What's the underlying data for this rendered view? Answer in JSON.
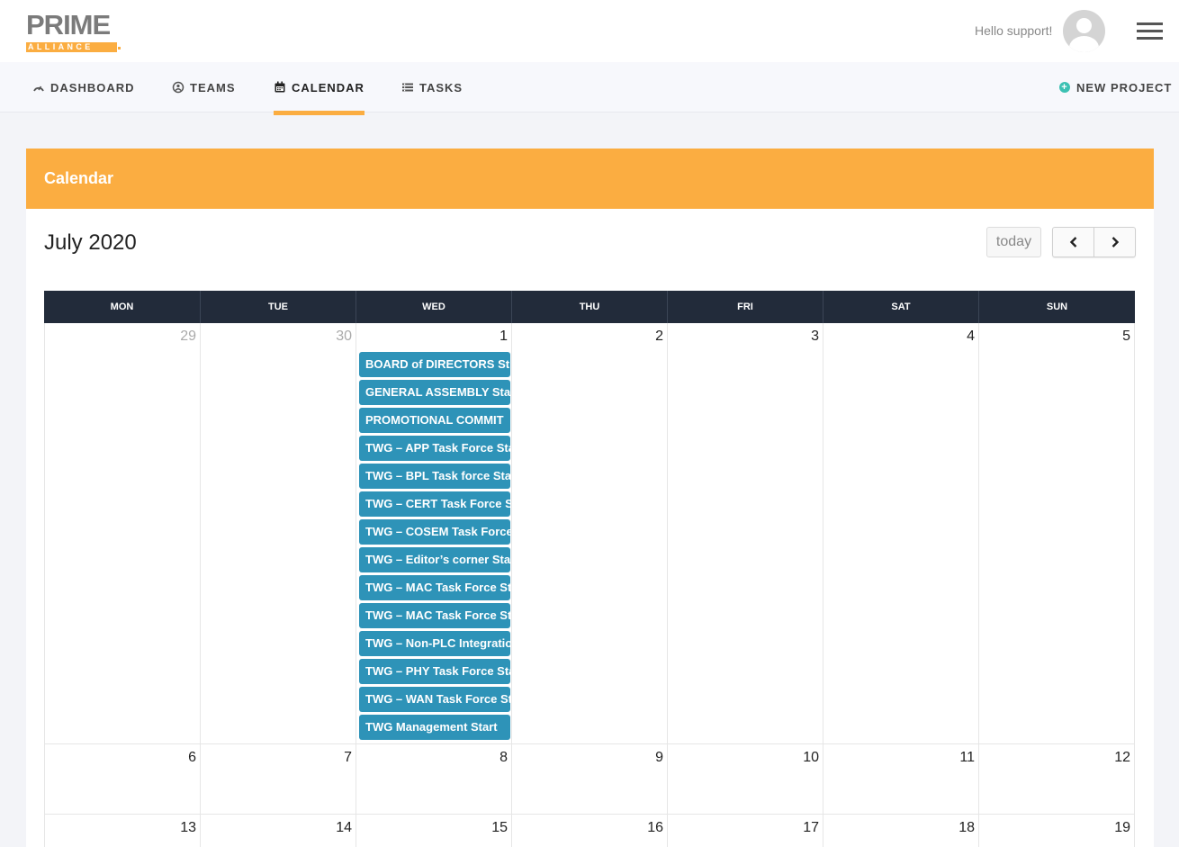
{
  "header": {
    "logo_main": "PRIME",
    "logo_sub": "ALLIANCE",
    "greeting": "Hello support!"
  },
  "nav": {
    "items": [
      {
        "label": "DASHBOARD",
        "icon": "gauge-icon"
      },
      {
        "label": "TEAMS",
        "icon": "teams-icon"
      },
      {
        "label": "CALENDAR",
        "icon": "calendar-icon",
        "active": true
      },
      {
        "label": "TASKS",
        "icon": "tasks-icon"
      }
    ],
    "new_project": "NEW PROJECT"
  },
  "card": {
    "title": "Calendar",
    "month": "July 2020",
    "today_label": "today"
  },
  "calendar": {
    "days_of_week": [
      "MON",
      "TUE",
      "WED",
      "THU",
      "FRI",
      "SAT",
      "SUN"
    ],
    "weeks": [
      [
        "29",
        "30",
        "1",
        "2",
        "3",
        "4",
        "5"
      ],
      [
        "6",
        "7",
        "8",
        "9",
        "10",
        "11",
        "12"
      ],
      [
        "13",
        "14",
        "15",
        "16",
        "17",
        "18",
        "19"
      ]
    ],
    "events_wed_1": [
      "BOARD of DIRECTORS St",
      "GENERAL ASSEMBLY Star",
      "PROMOTIONAL COMMIT",
      "TWG – APP Task Force Sta",
      "TWG – BPL Task force Star",
      "TWG – CERT Task Force S",
      "TWG – COSEM Task Force",
      "TWG – Editor’s corner Sta",
      "TWG – MAC Task Force St",
      "TWG – MAC Task Force St",
      "TWG – Non-PLC Integratio",
      "TWG – PHY Task Force Sta",
      "TWG – WAN Task Force St",
      "TWG Management Start"
    ]
  },
  "colors": {
    "accent": "#fbad41",
    "event": "#2e93b8",
    "header_dark": "#222b3a",
    "plus": "#3cc1b3"
  }
}
